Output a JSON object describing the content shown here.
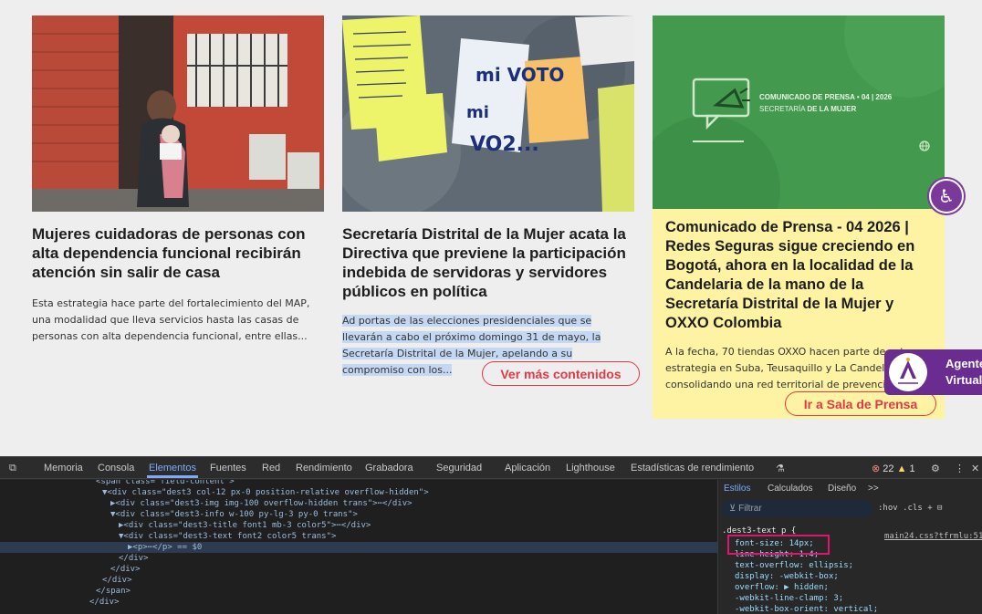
{
  "cards": [
    {
      "title": "Mujeres cuidadoras de personas con alta dependencia funcional recibirán atención sin salir de casa",
      "text": "Esta estrategia hace parte del fortalecimiento del MAP, una modalidad que lleva servicios hasta las casas de personas con alta dependencia funcional, entre ellas..."
    },
    {
      "title": "Secretaría Distrital de la Mujer acata la Directiva que previene la participación indebida de servidoras y servidores públicos en política",
      "text": "Ad portas de las elecciones presidenciales que se llevarán a cabo el próximo domingo 31 de mayo, la Secretaría Distrital de la Mujer, apelando a su compromiso con los...",
      "button": "Ver más contenidos",
      "notes": [
        "mi VOTO",
        "mi",
        "VO2..."
      ]
    },
    {
      "title": "Comunicado de Prensa - 04 2026 | Redes Seguras sigue creciendo en Bogotá, ahora en la localidad de la Candelaria de la mano de la Secretaría Distrital de la Mujer y OXXO Colombia",
      "text": "A la fecha, 70 tiendas OXXO hacen parte de esta estrategia en Suba, Teusaquillo y La Candelaria, consolidando una red territorial de prevención",
      "button": "Ir a Sala de Prensa",
      "banner_line1": "COMUNICADO DE PRENSA • 04 | 2026",
      "banner_line2_a": "SECRETARÍA ",
      "banner_line2_b": "DE LA MUJER"
    }
  ],
  "agent": {
    "line1": "Agente",
    "line2": "Virtual"
  },
  "devtools": {
    "tabs": [
      "Memoria",
      "Consola",
      "Elementos",
      "Fuentes",
      "Red",
      "Rendimiento",
      "Grabadora",
      "Seguridad",
      "Aplicación",
      "Lighthouse",
      "Estadísticas de rendimiento"
    ],
    "active_tab": "Elementos",
    "error_count": "22",
    "warning_count": "1",
    "style_tabs": [
      "Estilos",
      "Calculados",
      "Diseño",
      ">>"
    ],
    "filter_placeholder": "Filtrar",
    "filter_tools": ":hov .cls",
    "selector": ".dest3-text p {",
    "source": "main24.css?tfrmlu:51",
    "props": [
      "font-size: 14px;",
      "line-height: 1.4;",
      "text-overflow: ellipsis;",
      "display: -webkit-box;",
      "overflow: ▶ hidden;",
      "-webkit-line-clamp: 3;",
      "-webkit-box-orient: vertical;"
    ],
    "dom_lines": [
      "<span class=\"field-content\">",
      "▼<div class=\"dest3 col-12 px-0 position-relative overflow-hidden\">",
      "▶<div class=\"dest3-img img-100 overflow-hidden trans\">⋯</div>",
      "▼<div class=\"dest3-info w-100 py-lg-3 py-0 trans\">",
      "▶<div class=\"dest3-title font1 mb-3 color5\">⋯</div>",
      "▼<div class=\"dest3-text font2 color5 trans\">",
      "▶<p>⋯</p> == $0",
      "</div>",
      "</div>",
      "</div>",
      "</span>",
      "</div>"
    ]
  }
}
